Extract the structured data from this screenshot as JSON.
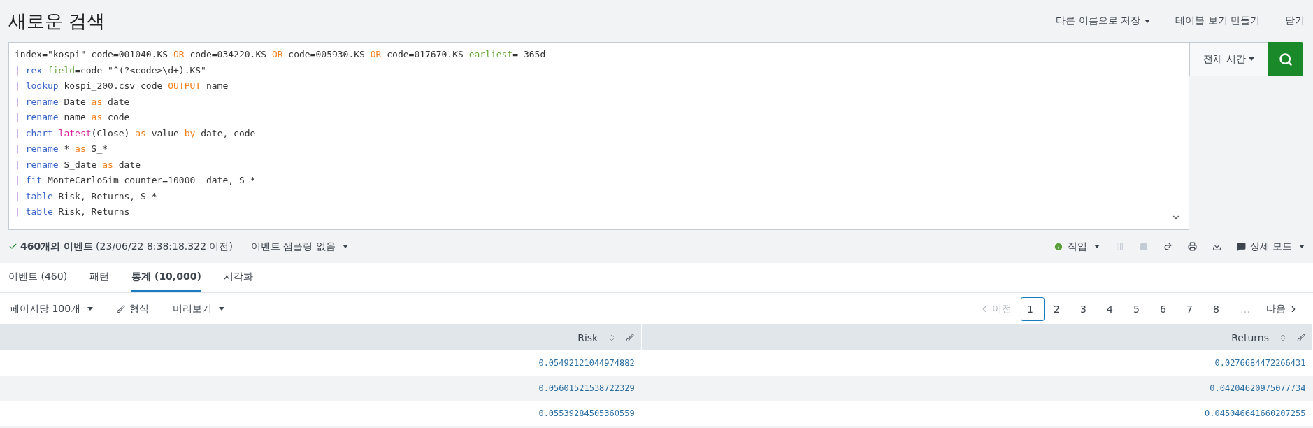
{
  "header": {
    "title": "새로운 검색",
    "actions": [
      {
        "label": "다른 이름으로 저장",
        "dropdown": true
      },
      {
        "label": "테이블 보기 만들기",
        "dropdown": false
      },
      {
        "label": "닫기",
        "dropdown": false
      }
    ]
  },
  "query": {
    "lines": [
      [
        {
          "text": "index=\"kospi\" code=001040.KS ",
          "kind": "plain"
        },
        {
          "text": "OR",
          "kind": "keyword"
        },
        {
          "text": " code=034220.KS ",
          "kind": "plain"
        },
        {
          "text": "OR",
          "kind": "keyword"
        },
        {
          "text": " code=005930.KS ",
          "kind": "plain"
        },
        {
          "text": "OR",
          "kind": "keyword"
        },
        {
          "text": " code=017670.KS ",
          "kind": "plain"
        },
        {
          "text": "earliest",
          "kind": "arg"
        },
        {
          "text": "=-365d",
          "kind": "plain"
        }
      ],
      [
        {
          "text": "| ",
          "kind": "pipe"
        },
        {
          "text": "rex ",
          "kind": "command"
        },
        {
          "text": "field",
          "kind": "arg"
        },
        {
          "text": "=code \"^(?<code>\\d+).KS\"",
          "kind": "plain"
        }
      ],
      [
        {
          "text": "| ",
          "kind": "pipe"
        },
        {
          "text": "lookup",
          "kind": "command"
        },
        {
          "text": " kospi_200.csv code ",
          "kind": "plain"
        },
        {
          "text": "OUTPUT",
          "kind": "keyword"
        },
        {
          "text": " name",
          "kind": "plain"
        }
      ],
      [
        {
          "text": "| ",
          "kind": "pipe"
        },
        {
          "text": "rename",
          "kind": "command"
        },
        {
          "text": " Date ",
          "kind": "plain"
        },
        {
          "text": "as",
          "kind": "keyword"
        },
        {
          "text": " date",
          "kind": "plain"
        }
      ],
      [
        {
          "text": "| ",
          "kind": "pipe"
        },
        {
          "text": "rename",
          "kind": "command"
        },
        {
          "text": " name ",
          "kind": "plain"
        },
        {
          "text": "as",
          "kind": "keyword"
        },
        {
          "text": " code",
          "kind": "plain"
        }
      ],
      [
        {
          "text": "| ",
          "kind": "pipe"
        },
        {
          "text": "chart ",
          "kind": "command"
        },
        {
          "text": "latest",
          "kind": "function"
        },
        {
          "text": "(Close) ",
          "kind": "plain"
        },
        {
          "text": "as",
          "kind": "keyword"
        },
        {
          "text": " value ",
          "kind": "plain"
        },
        {
          "text": "by",
          "kind": "keyword"
        },
        {
          "text": " date, code",
          "kind": "plain"
        }
      ],
      [
        {
          "text": "| ",
          "kind": "pipe"
        },
        {
          "text": "rename",
          "kind": "command"
        },
        {
          "text": " * ",
          "kind": "plain"
        },
        {
          "text": "as",
          "kind": "keyword"
        },
        {
          "text": " S_*",
          "kind": "plain"
        }
      ],
      [
        {
          "text": "| ",
          "kind": "pipe"
        },
        {
          "text": "rename",
          "kind": "command"
        },
        {
          "text": " S_date ",
          "kind": "plain"
        },
        {
          "text": "as",
          "kind": "keyword"
        },
        {
          "text": " date",
          "kind": "plain"
        }
      ],
      [
        {
          "text": "| ",
          "kind": "pipe"
        },
        {
          "text": "fit",
          "kind": "command"
        },
        {
          "text": " MonteCarloSim counter=10000  date, S_*",
          "kind": "plain"
        }
      ],
      [
        {
          "text": "| ",
          "kind": "pipe"
        },
        {
          "text": "table",
          "kind": "command"
        },
        {
          "text": " Risk, Returns, S_*",
          "kind": "plain"
        }
      ],
      [
        {
          "text": "| ",
          "kind": "pipe"
        },
        {
          "text": "table",
          "kind": "command"
        },
        {
          "text": " Risk, Returns",
          "kind": "plain"
        }
      ]
    ],
    "time_picker": "전체 시간"
  },
  "status": {
    "count": "460개의 이벤트",
    "time": "(23/06/22 8:38:18.322 이전)",
    "sampling": "이벤트 샘플링 없음",
    "job": "작업",
    "mode": "상세 모드"
  },
  "tabs": [
    {
      "label": "이벤트 (460)",
      "selected": false
    },
    {
      "label": "패턴",
      "selected": false
    },
    {
      "label": "통계 (10,000)",
      "selected": true
    },
    {
      "label": "시각화",
      "selected": false
    }
  ],
  "options": {
    "per_page": "페이지당 100개",
    "format": "형식",
    "preview": "미리보기"
  },
  "pagination": {
    "prev": "이전",
    "prev_disabled": true,
    "pages": [
      {
        "label": "1",
        "selected": true
      },
      {
        "label": "2",
        "selected": false
      },
      {
        "label": "3",
        "selected": false
      },
      {
        "label": "4",
        "selected": false
      },
      {
        "label": "5",
        "selected": false
      },
      {
        "label": "6",
        "selected": false
      },
      {
        "label": "7",
        "selected": false
      },
      {
        "label": "8",
        "selected": false
      }
    ],
    "ellipsis": "…",
    "next": "다음"
  },
  "table": {
    "columns": [
      "Risk",
      "Returns"
    ],
    "rows": [
      [
        "0.05492121044974882",
        "0.0276684472266431"
      ],
      [
        "0.05601521538722329",
        "0.04204620975077734"
      ],
      [
        "0.05539284505360559",
        "0.045046641660207255"
      ]
    ]
  }
}
